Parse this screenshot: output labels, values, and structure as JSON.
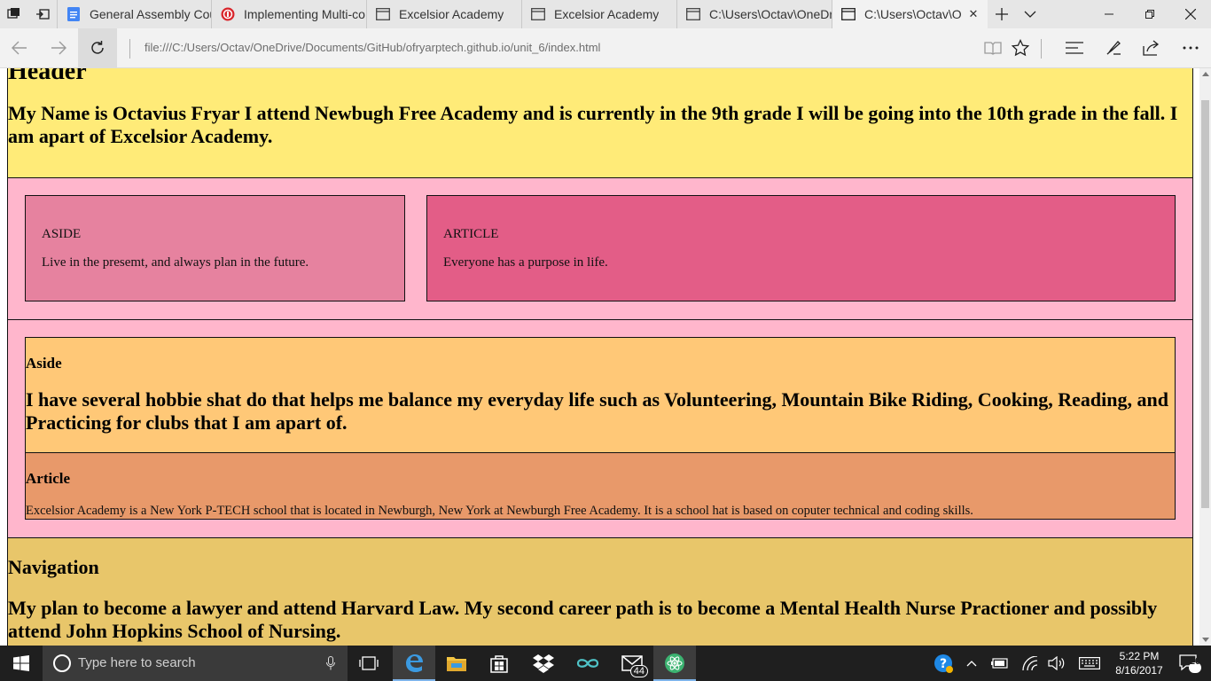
{
  "browser": {
    "tabs": [
      {
        "title": "General Assembly Cour",
        "icon": "google-docs-icon",
        "active": false
      },
      {
        "title": "Implementing Multi-co",
        "icon": "red-badge-icon",
        "active": false
      },
      {
        "title": "Excelsior Academy",
        "icon": "page-icon",
        "active": false
      },
      {
        "title": "Excelsior Academy",
        "icon": "page-icon",
        "active": false
      },
      {
        "title": "C:\\Users\\Octav\\OneDriv",
        "icon": "page-icon",
        "active": false
      },
      {
        "title": "C:\\Users\\Octav\\One",
        "icon": "page-icon",
        "active": true
      }
    ],
    "url": "file:///C:/Users/Octav/OneDrive/Documents/GitHub/ofryarptech.github.io/unit_6/index.html"
  },
  "page": {
    "header": {
      "title": "Header",
      "text": "My Name is Octavius Fryar I attend Newbugh Free Academy and is currently in the 9th grade I will be going into the 10th grade in the fall. I am apart of Excelsior Academy."
    },
    "row1": {
      "aside": {
        "label": "ASIDE",
        "text": "Live in the presemt, and always plan in the future."
      },
      "article": {
        "label": "ARTICLE",
        "text": "Everyone has a purpose in life."
      }
    },
    "row2": {
      "aside": {
        "heading": "Aside",
        "text": "I have several hobbie shat do that helps me balance my everyday life such as Volunteering, Mountain Bike Riding, Cooking, Reading, and Practicing for clubs that I am apart of."
      },
      "article": {
        "heading": "Article",
        "text": "Excelsior Academy is a New York P-TECH school that is located in Newburgh, New York at Newburgh Free Academy. It is a school hat is based on coputer technical and coding skills."
      }
    },
    "navigation": {
      "heading": "Navigation",
      "text": "My plan to become a lawyer and attend Harvard Law. My second career path is to become a Mental Health Nurse Practioner and possibly attend John Hopkins School of Nursing."
    }
  },
  "taskbar": {
    "search_placeholder": "Type here to search",
    "mail_badge": "44",
    "notification_count": "20",
    "time": "5:22 PM",
    "date": "8/16/2017"
  },
  "colors": {
    "header_bg": "#ffeb78",
    "row_bg": "#ffb6cc",
    "aside1_bg": "#e6829f",
    "article1_bg": "#e35d87",
    "aside2_bg": "#ffc877",
    "article2_bg": "#e8996a",
    "nav_bg": "#e8c66a"
  }
}
